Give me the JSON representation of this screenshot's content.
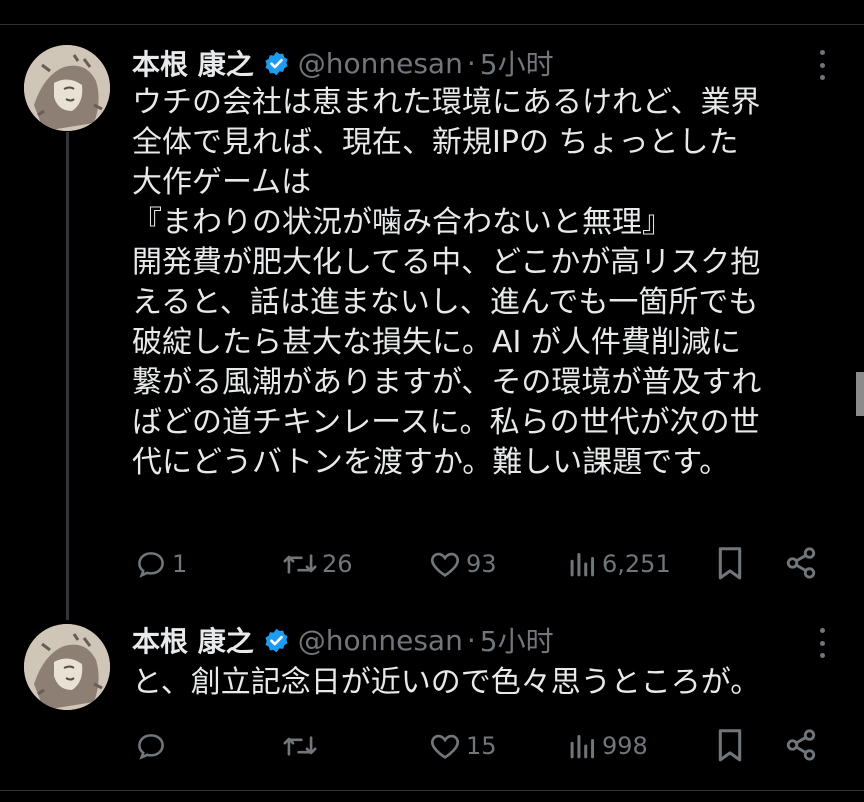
{
  "tweets": [
    {
      "author_name": "本根 康之",
      "handle": "@honnesan",
      "separator": "·",
      "time": "5小时",
      "text": "ウチの会社は恵まれた環境にあるけれど、業界\n全体で見れば、現在、新規IPの ちょっとした\n大作ゲームは\n『まわりの状況が噛み合わないと無理』\n開発費が肥大化してる中、どこかが高リスク抱\nえると、話は進まないし、進んでも一箇所でも\n破綻したら甚大な損失に。AI が人件費削減に\n繋がる風潮がありますが、その環境が普及すれ\nばどの道チキンレースに。私らの世代が次の世\n代にどうバトンを渡すか。難しい課題です。",
      "replies": "1",
      "retweets": "26",
      "likes": "93",
      "views": "6,251"
    },
    {
      "author_name": "本根 康之",
      "handle": "@honnesan",
      "separator": "·",
      "time": "5小时",
      "text": "と、創立記念日が近いので色々思うところが。",
      "replies": "",
      "retweets": "",
      "likes": "15",
      "views": "998"
    }
  ],
  "icons": {
    "verified": "verified-badge-icon",
    "reply": "reply-icon",
    "retweet": "retweet-icon",
    "like": "heart-icon",
    "views": "views-icon",
    "bookmark": "bookmark-icon",
    "share": "share-icon",
    "more": "more-icon"
  },
  "colors": {
    "background": "#000000",
    "text": "#e7e9ea",
    "muted": "#71767b",
    "verified": "#1d9bf0",
    "thread_line": "#333639"
  }
}
